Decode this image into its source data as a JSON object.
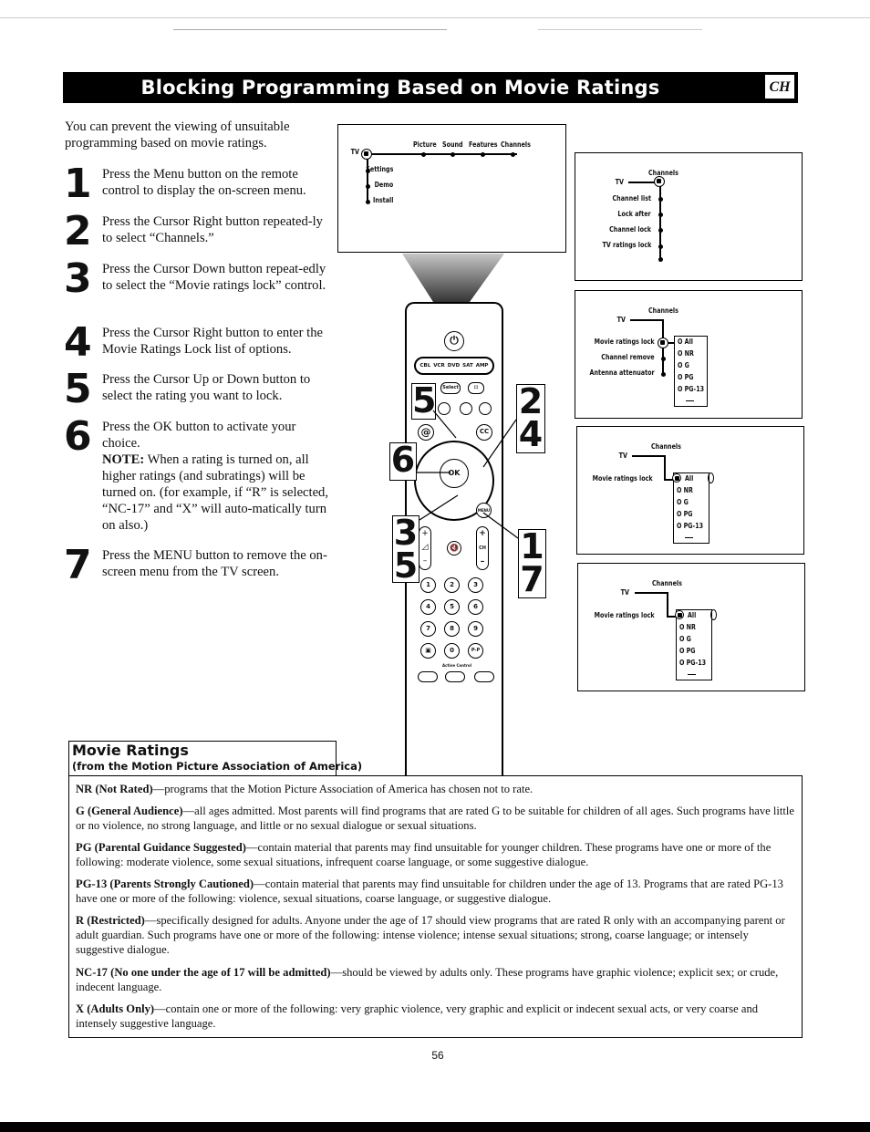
{
  "header": {
    "title": "Blocking Programming Based on Movie Ratings",
    "section_badge": "CH"
  },
  "intro": "You can prevent the viewing of unsuitable programming based on movie ratings.",
  "steps": [
    {
      "number": "1",
      "text": "Press the Menu button on the remote control to display the on-screen menu."
    },
    {
      "number": "2",
      "text": "Press the Cursor Right button repeated-ly to select “Channels.”"
    },
    {
      "number": "3",
      "text": "Press the Cursor Down button repeat-edly to select the “Movie ratings lock” control."
    },
    {
      "number": "4",
      "text": "Press the Cursor Right button to enter the Movie Ratings Lock list of options."
    },
    {
      "number": "5",
      "text": "Press the Cursor Up or Down button to select the rating you want to lock."
    },
    {
      "number": "6",
      "text": "Press the OK button to activate your choice.",
      "note_label": "NOTE:",
      "note": " When a rating is turned on, all higher ratings (and subratings) will be turned on. (for example, if “R” is selected, “NC-17” and “X” will auto-matically turn on also.)"
    },
    {
      "number": "7",
      "text": "Press the MENU button to remove the on-screen menu from the TV screen."
    }
  ],
  "screens": {
    "main_menu": {
      "root": "TV",
      "top_items": [
        "Picture",
        "Sound",
        "Features",
        "Channels"
      ],
      "side_items": [
        "Settings",
        "Demo",
        "Install"
      ]
    },
    "channels_menu": {
      "root": "TV",
      "header": "Channels",
      "items": [
        "Channel list",
        "Lock after",
        "Channel lock",
        "TV ratings lock"
      ]
    },
    "movie_lock_menu": {
      "root": "TV",
      "header": "Channels",
      "items": [
        "Movie ratings lock",
        "Channel remove",
        "Antenna attenuator"
      ],
      "options": [
        "O All",
        "O NR",
        "O G",
        "O PG",
        "O PG-13",
        "—"
      ]
    },
    "movie_lock_select_1": {
      "root": "TV",
      "header": "Channels",
      "item": "Movie ratings lock",
      "options": [
        "All",
        "O NR",
        "O G",
        "O PG",
        "O PG-13",
        "—"
      ]
    },
    "movie_lock_select_2": {
      "root": "TV",
      "header": "Channels",
      "item": "Movie ratings lock",
      "options": [
        "All",
        "O NR",
        "O G",
        "O PG",
        "O PG-13",
        "—"
      ]
    }
  },
  "remote": {
    "source_buttons": [
      "CBL",
      "VCR",
      "DVD",
      "SAT",
      "AMP"
    ],
    "select_label": "Select",
    "ok_label": "OK",
    "menu_label": "MENU",
    "cc_label": "CC",
    "ch_label": "CH",
    "number_keys": [
      "1",
      "2",
      "3",
      "4",
      "5",
      "6",
      "7",
      "8",
      "9",
      "▣",
      "0",
      "P-P"
    ],
    "active_control_label": "Active Control",
    "step_callouts": {
      "top_left": "5",
      "left": "6",
      "right_top": "2\n4",
      "bottom_left": "3\n5",
      "bottom_right": "1\n7"
    }
  },
  "ratings": {
    "title": "Movie Ratings",
    "subtitle": "(from the Motion Picture Association of America)",
    "items": [
      {
        "label": "NR (Not Rated)",
        "text": "—programs that the Motion Picture Association of America has chosen not to rate."
      },
      {
        "label": "G (General Audience)",
        "text": "—all ages admitted. Most parents will find programs that are rated G to be suitable for children of all ages. Such programs have little or no violence, no strong language, and little or no sexual dialogue or sexual situations."
      },
      {
        "label": "PG (Parental Guidance Suggested)",
        "text": "—contain material that parents may find unsuitable for younger children. These programs have one or more of the following: moderate violence, some sexual situations, infrequent coarse language, or some suggestive dialogue."
      },
      {
        "label": "PG-13 (Parents Strongly Cautioned)",
        "text": "—contain material that parents may find unsuitable for children under the age of 13. Programs that are rated PG-13 have one or more of the following: violence, sexual situations, coarse language, or suggestive dialogue."
      },
      {
        "label": "R (Restricted)",
        "text": "—specifically designed for adults. Anyone under the age of 17 should view programs that are rated R only with an accompanying parent or adult guardian. Such programs have one or more of the following: intense violence; intense sexual situations; strong, coarse language; or intensely suggestive dialogue."
      },
      {
        "label": "NC-17 (No one under the age of 17 will be admitted)",
        "text": "—should be viewed by adults only. These programs have graphic violence; explicit sex; or crude, indecent language."
      },
      {
        "label": "X (Adults Only)",
        "text": "—contain one or more of the following: very graphic violence, very graphic and explicit or indecent sexual acts, or very coarse and intensely suggestive language."
      }
    ]
  },
  "footer": {
    "page_number": "56"
  }
}
